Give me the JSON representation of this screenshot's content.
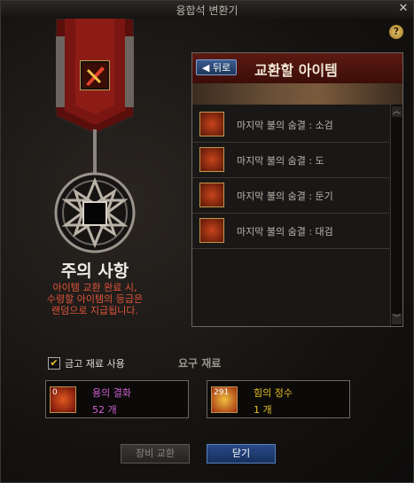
{
  "window": {
    "title": "융합석 변환기",
    "close_symbol": "✕"
  },
  "help_symbol": "?",
  "notice": {
    "title": "주의 사항",
    "lines": [
      "아이템 교환 완료 시,",
      "수령할 아이템의 등급은",
      "랜덤으로 지급됩니다."
    ]
  },
  "exchange_panel": {
    "back_label": "◀ 뒤로",
    "title": "교환할 아이템",
    "items": [
      {
        "label": "마지막 불의 숨결 : 소검",
        "icon": "sword-icon"
      },
      {
        "label": "마지막 불의 숨결 : 도",
        "icon": "blade-icon"
      },
      {
        "label": "마지막 불의 숨결 : 둔기",
        "icon": "mace-icon"
      },
      {
        "label": "마지막 불의 숨결 : 대검",
        "icon": "greatsword-icon"
      }
    ],
    "scroll_up": "︿",
    "scroll_down": "﹀"
  },
  "options": {
    "use_vault_materials_label": "금고 재료 사용",
    "use_vault_materials_checked": true,
    "check_mark": "✔"
  },
  "required_materials": {
    "label": "요구 재료",
    "materials": [
      {
        "name": "용의 결화",
        "quantity": "52 개",
        "badge": "0",
        "name_color": "#d060d0",
        "qty_color": "#d060d0",
        "icon": "dragon-flame-icon"
      },
      {
        "name": "힘의 정수",
        "quantity": "1 개",
        "badge": "291",
        "name_color": "#e8c020",
        "qty_color": "#e8c020",
        "icon": "power-essence-icon"
      }
    ]
  },
  "buttons": {
    "exchange_label": "장비 교환",
    "close_label": "닫기"
  },
  "colors": {
    "accent_red": "#5b1a12",
    "notice_text": "#e0543a",
    "close_button": "#1e3a6e"
  }
}
